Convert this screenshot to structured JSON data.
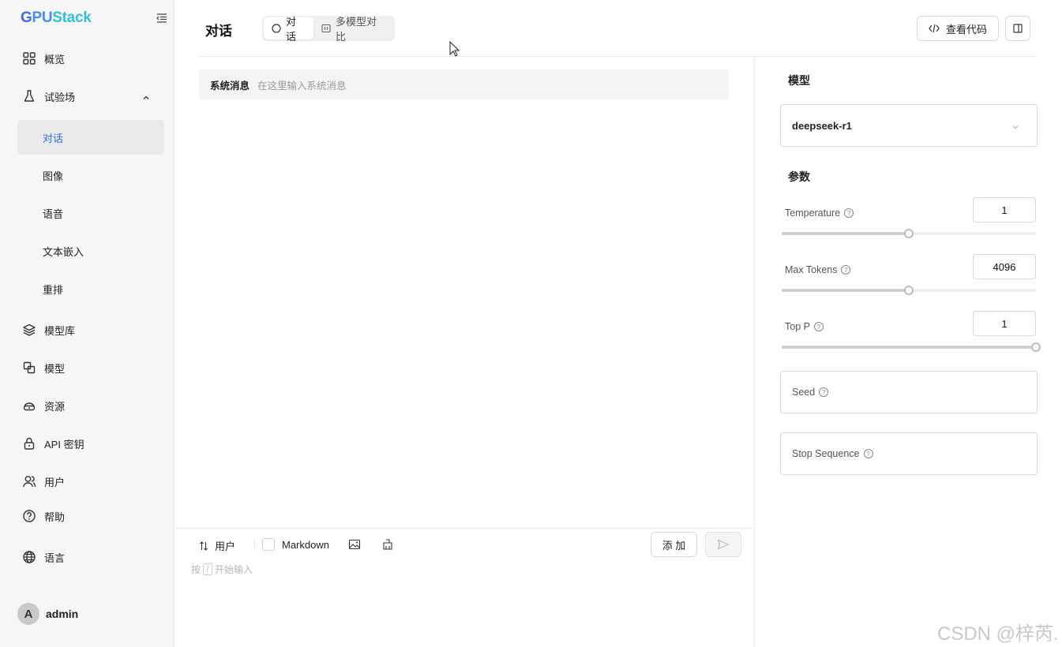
{
  "app": {
    "logo": {
      "part1": "G",
      "part2": "PU",
      "part3": "Stack"
    }
  },
  "sidebar": {
    "items": [
      {
        "label": "概览",
        "icon": "grid-icon"
      },
      {
        "label": "试验场",
        "icon": "flask-icon"
      },
      {
        "label": "模型库",
        "icon": "layers-icon"
      },
      {
        "label": "模型",
        "icon": "model-icon"
      },
      {
        "label": "资源",
        "icon": "resource-icon"
      },
      {
        "label": "API 密钥",
        "icon": "lock-icon"
      },
      {
        "label": "用户",
        "icon": "users-icon"
      },
      {
        "label": "帮助",
        "icon": "help-icon"
      },
      {
        "label": "语言",
        "icon": "globe-icon"
      }
    ],
    "playground_sub": [
      {
        "label": "对话",
        "active": true
      },
      {
        "label": "图像"
      },
      {
        "label": "语音"
      },
      {
        "label": "文本嵌入"
      },
      {
        "label": "重排"
      }
    ],
    "user": {
      "avatar_letter": "A",
      "name": "admin"
    }
  },
  "header": {
    "title": "对话",
    "segments": [
      {
        "label": "对话",
        "icon": "chat-circle-icon",
        "selected": true
      },
      {
        "label": "多模型对比",
        "icon": "compare-icon",
        "selected": false
      }
    ],
    "view_code_label": "查看代码",
    "panel_toggle_icon": "panel-icon"
  },
  "chat": {
    "system_label": "系统消息",
    "system_placeholder": "在这里输入系统消息",
    "role_label": "用户",
    "markdown_label": "Markdown",
    "add_label": "添 加",
    "hint_before": "按",
    "hint_key": "/",
    "hint_after": "开始输入"
  },
  "settings": {
    "model_title": "模型",
    "model_value": "deepseek-r1",
    "params_title": "参数",
    "params": [
      {
        "label": "Temperature",
        "value": "1",
        "fraction": 0.5
      },
      {
        "label": "Max Tokens",
        "value": "4096",
        "fraction": 0.5
      },
      {
        "label": "Top P",
        "value": "1",
        "fraction": 1.0
      }
    ],
    "seed_label": "Seed",
    "stop_label": "Stop Sequence"
  },
  "watermark": "CSDN @梓芮."
}
